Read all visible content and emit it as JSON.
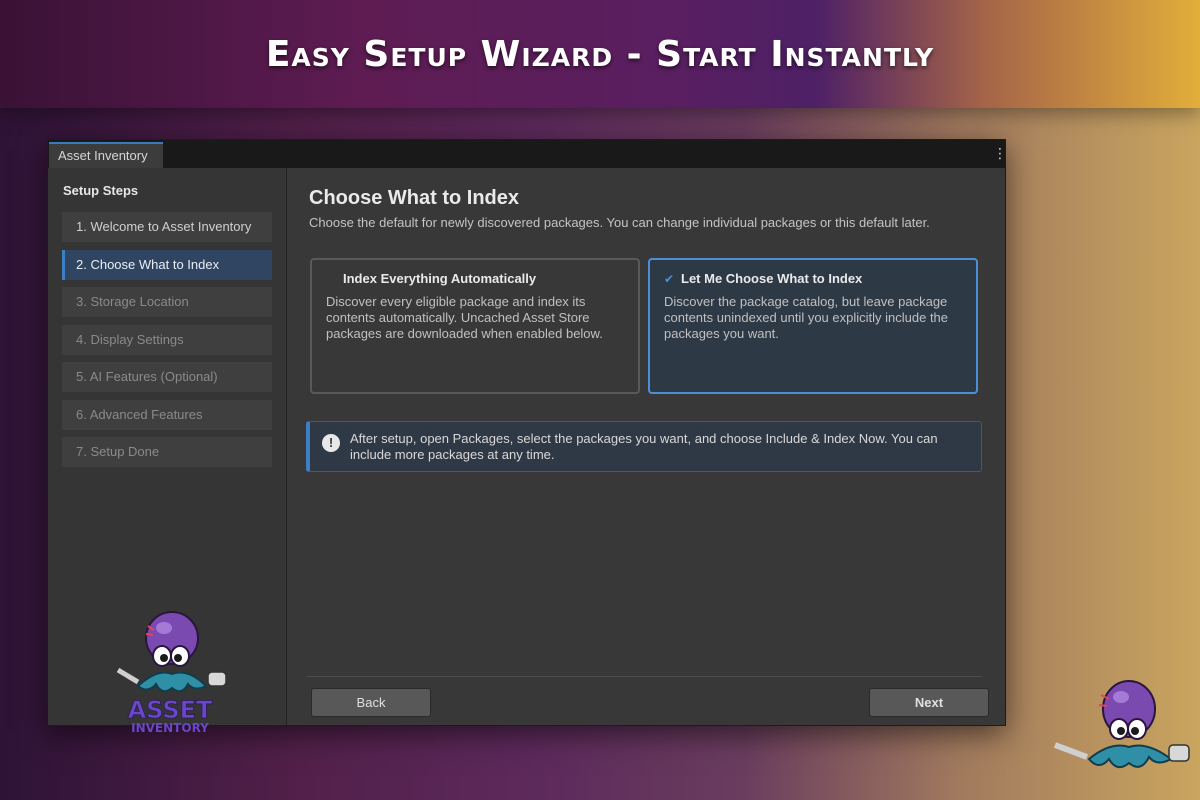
{
  "banner": {
    "title": "Easy Setup Wizard - Start Instantly"
  },
  "window": {
    "tab_label": "Asset Inventory",
    "menu_icon": "kebab-menu-icon"
  },
  "sidebar": {
    "title": "Setup Steps",
    "steps": [
      {
        "label": "1. Welcome to Asset Inventory",
        "state": "done"
      },
      {
        "label": "2. Choose What to Index",
        "state": "active"
      },
      {
        "label": "3. Storage Location",
        "state": "pending"
      },
      {
        "label": "4. Display Settings",
        "state": "pending"
      },
      {
        "label": "5. AI Features (Optional)",
        "state": "pending"
      },
      {
        "label": "6. Advanced Features",
        "state": "pending"
      },
      {
        "label": "7. Setup Done",
        "state": "pending"
      }
    ],
    "logo": {
      "line1": "ASSET",
      "line2": "INVENTORY"
    }
  },
  "main": {
    "title": "Choose What to Index",
    "description": "Choose the default for newly discovered packages. You can change individual packages or this default later.",
    "options": [
      {
        "title": "Index Everything Automatically",
        "text": "Discover every eligible package and index its contents automatically. Uncached Asset Store packages are downloaded when enabled below.",
        "selected": false
      },
      {
        "title": "Let Me Choose What to Index",
        "text": "Discover the package catalog, but leave package contents unindexed until you explicitly include the packages you want.",
        "selected": true
      }
    ],
    "info": {
      "icon": "exclamation-info-icon",
      "text": "After setup, open Packages, select the packages you want, and choose Include & Index Now. You can include more packages at any time."
    },
    "back_label": "Back",
    "next_label": "Next"
  },
  "colors": {
    "accent": "#3d7fc4",
    "window_bg": "#383838",
    "sidebar_bg": "#353535",
    "selected_card_bg": "#2e3946",
    "octopus_purple": "#7a4ab0",
    "octopus_teal": "#2f8fa6"
  }
}
